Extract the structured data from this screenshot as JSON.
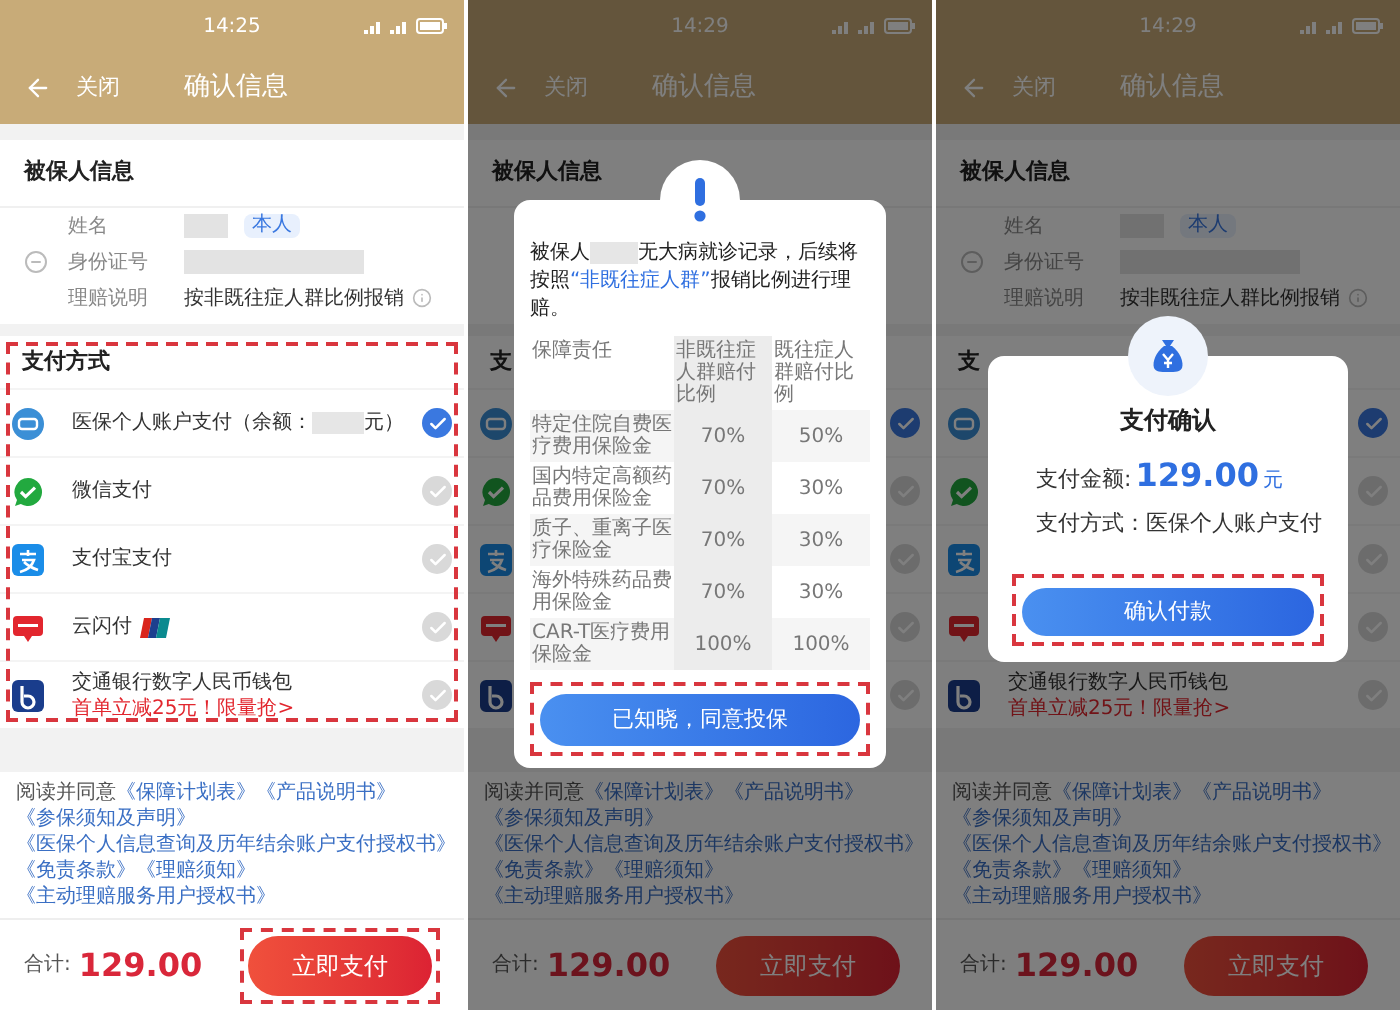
{
  "screens": [
    {
      "status_time": "14:25",
      "nav": {
        "close": "关闭",
        "title": "确认信息"
      },
      "dimmed": false,
      "insured": {
        "title": "被保人信息",
        "rows": [
          {
            "kind": "name",
            "label": "姓名",
            "badge": "本人"
          },
          {
            "kind": "id",
            "label": "身份证号"
          },
          {
            "kind": "text",
            "label": "理赔说明",
            "value": "按非既往症人群比例报销"
          }
        ]
      },
      "payment": {
        "title": "支付方式",
        "highlighted": true,
        "methods": [
          {
            "kind": "medical",
            "label": "医保个人账户支付（余额：",
            "suffix": "元）",
            "selected": true
          },
          {
            "kind": "wechat",
            "label": "微信支付",
            "selected": false
          },
          {
            "kind": "alipay",
            "label": "支付宝支付",
            "selected": false
          },
          {
            "kind": "cloud",
            "label": "云闪付",
            "selected": false
          },
          {
            "kind": "bank",
            "label": "交通银行数字人民币钱包",
            "promo": "首单立减25元！限量抢>",
            "selected": false
          }
        ]
      },
      "agreement": {
        "prefix": "阅读并同意",
        "links": [
          "《保障计划表》",
          "《产品说明书》",
          "《参保须知及声明》",
          "《医保个人信息查询及历年结余账户支付授权书》",
          "《免责条款》",
          "《理赔须知》",
          "《主动理赔服务用户授权书》"
        ]
      },
      "total": {
        "label": "合计:",
        "amount": "129.00"
      },
      "submit": {
        "label": "立即支付",
        "highlighted": true
      }
    },
    {
      "status_time": "14:29",
      "nav": {
        "close": "关闭",
        "title": "确认信息"
      },
      "dimmed": true,
      "insured": {
        "title": "被保人信息"
      },
      "payment": {
        "title": "支",
        "highlighted": false,
        "methods": [
          {
            "kind": "medical",
            "selected": true
          },
          {
            "kind": "wechat",
            "selected": false
          },
          {
            "kind": "alipay",
            "selected": false
          },
          {
            "kind": "cloud",
            "selected": false
          },
          {
            "kind": "bank",
            "selected": false
          }
        ]
      },
      "agreement": {
        "prefix": "阅读并同意",
        "links": [
          "《保障计划表》",
          "《产品说明书》",
          "《参保须知及声明》",
          "《医保个人信息查询及历年结余账户支付授权书》",
          "《免责条款》",
          "《理赔须知》",
          "《主动理赔服务用户授权书》"
        ]
      },
      "total": {
        "label": "合计:",
        "amount": "129.00"
      },
      "submit": {
        "label": "立即支付",
        "highlighted": false
      },
      "dialog": {
        "kind": "notice",
        "message": {
          "before": "被保人",
          "after": "无大病就诊记录，后续将按照",
          "highlight": "“非既往症人群”",
          "end": "报销比例进行理赔。"
        },
        "table": {
          "columns": [
            "保障责任",
            "非既往症人群赔付比例",
            "既往症人群赔付比例"
          ],
          "rows": [
            [
              "特定住院自费医疗费用保险金",
              "70%",
              "50%"
            ],
            [
              "国内特定高额药品费用保险金",
              "70%",
              "30%"
            ],
            [
              "质子、重离子医疗保险金",
              "70%",
              "30%"
            ],
            [
              "海外特殊药品费用保险金",
              "70%",
              "30%"
            ],
            [
              "CAR-T医疗费用保险金",
              "100%",
              "100%"
            ]
          ]
        },
        "button": {
          "label": "已知晓，同意投保",
          "highlighted": true
        }
      }
    },
    {
      "status_time": "14:29",
      "nav": {
        "close": "关闭",
        "title": "确认信息"
      },
      "dimmed": true,
      "insured": {
        "title": "被保人信息",
        "rows": [
          {
            "kind": "name",
            "label": "姓名",
            "badge": "本人"
          },
          {
            "kind": "id",
            "label": "身份证号"
          },
          {
            "kind": "text",
            "label": "理赔说明",
            "value": "按非既往症人群比例报销"
          }
        ]
      },
      "payment": {
        "title": "支",
        "highlighted": false,
        "methods": [
          {
            "kind": "medical",
            "selected": true
          },
          {
            "kind": "wechat",
            "selected": false
          },
          {
            "kind": "alipay",
            "selected": false
          },
          {
            "kind": "cloud",
            "selected": false
          },
          {
            "kind": "bank",
            "label": "交通银行数字人民币钱包",
            "promo": "首单立减25元！限量抢>",
            "selected": false
          }
        ]
      },
      "agreement": {
        "prefix": "阅读并同意",
        "links": [
          "《保障计划表》",
          "《产品说明书》",
          "《参保须知及声明》",
          "《医保个人信息查询及历年结余账户支付授权书》",
          "《免责条款》",
          "《理赔须知》",
          "《主动理赔服务用户授权书》"
        ]
      },
      "total": {
        "label": "合计:",
        "amount": "129.00"
      },
      "submit": {
        "label": "立即支付",
        "highlighted": false
      },
      "dialog": {
        "kind": "confirm",
        "title": "支付确认",
        "amount_label": "支付金额:",
        "amount": "129.00",
        "currency": "元",
        "method_label": "支付方式：",
        "method": "医保个人账户支付",
        "button": {
          "label": "确认付款",
          "highlighted": true
        }
      }
    }
  ]
}
